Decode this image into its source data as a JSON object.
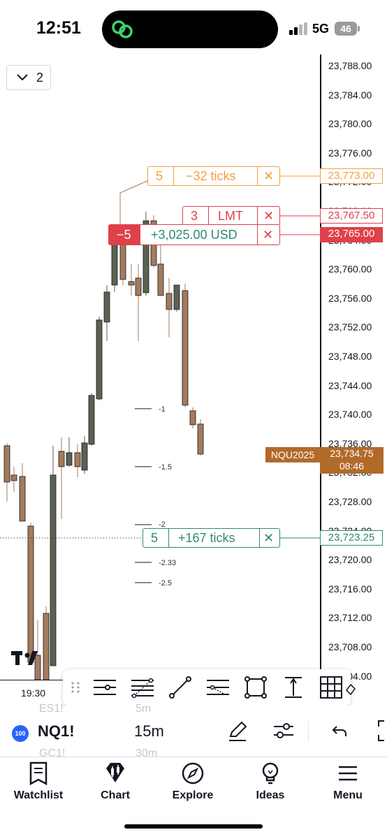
{
  "status_bar": {
    "time": "12:51",
    "network": "5G",
    "battery": "46"
  },
  "chart": {
    "collapse_count": "2",
    "price_ticks": [
      "23,788.00",
      "23,784.00",
      "23,780.00",
      "23,776.00",
      "23,772.00",
      "23,768.00",
      "23,764.00",
      "23,760.00",
      "23,756.00",
      "23,752.00",
      "23,748.00",
      "23,744.00",
      "23,740.00",
      "23,736.00",
      "23,732.00",
      "23,728.00",
      "23,724.00",
      "23,720.00",
      "23,716.00",
      "23,712.00",
      "23,708.00",
      "23,704.00"
    ],
    "orders": [
      {
        "qty": "5",
        "text": "−32 ticks",
        "close": "✕",
        "price": "23,773.00",
        "color": "#f0a040"
      },
      {
        "qty": "3",
        "text": "LMT",
        "close": "✕",
        "price": "23,767.50",
        "color": "#e0404a"
      },
      {
        "qty": "−5",
        "text": "+3,025.00 USD",
        "close": "✕",
        "price": "23,765.00",
        "color": "#e0404a",
        "text_color": "#2e8b6e"
      },
      {
        "qty": "5",
        "text": "+167 ticks",
        "close": "✕",
        "price": "23,723.25",
        "color": "#2e8b6e"
      }
    ],
    "fib_levels": [
      "-1",
      "-1.5",
      "-2",
      "-2.33",
      "-2.5"
    ],
    "symbol_tag": "NQU2025",
    "last_price": "23,734.75",
    "countdown": "08:46",
    "time_label": "19:30"
  },
  "drawing_toolbar": {
    "tools": [
      "drag-handle-icon",
      "horizontal-lines-icon",
      "fib-retracement-icon",
      "trend-line-icon",
      "parallel-channel-icon",
      "rectangle-icon",
      "vertical-measure-icon",
      "grid-icon",
      "eraser-icon"
    ]
  },
  "symbol_bar": {
    "badge": "100",
    "symbol": "NQ1!",
    "interval": "15m",
    "ghost_above_symbol": "ES1!",
    "ghost_above_interval": "5m",
    "ghost_below_symbol": "GC1!",
    "ghost_below_interval": "30m"
  },
  "bottom_nav": {
    "items": [
      {
        "label": "Watchlist",
        "icon": "watchlist-icon"
      },
      {
        "label": "Chart",
        "icon": "chart-icon"
      },
      {
        "label": "Explore",
        "icon": "compass-icon"
      },
      {
        "label": "Ideas",
        "icon": "lightbulb-icon"
      },
      {
        "label": "Menu",
        "icon": "hamburger-icon"
      }
    ]
  },
  "colors": {
    "up_candle": "#5c6152",
    "down_candle": "#a47b5c",
    "accent": "#2962ff",
    "last_price_bg": "#b26a2a"
  }
}
